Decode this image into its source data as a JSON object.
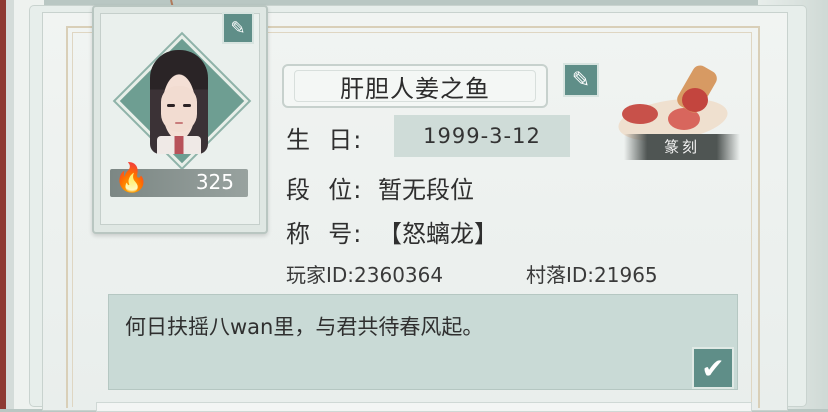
{
  "profile": {
    "nickname": "肝胆人姜之鱼",
    "heat_value": "325",
    "birthday_label": "生  日:",
    "birthday_value": "1999-3-12",
    "rank_label": "段  位:",
    "rank_value": "暂无段位",
    "title_label": "称  号:",
    "title_value": "【怒螭龙】",
    "player_id": "玩家ID:2360364",
    "village_id": "村落ID:21965",
    "signature": "何日扶摇八wan里，与君共待春风起。"
  },
  "stamp": {
    "label": "篆刻"
  },
  "icons": {
    "edit": "pencil-icon",
    "confirm": "checkmark-icon",
    "heat": "flame-icon"
  },
  "colors": {
    "button": "#5f8e88",
    "panel": "#c9dad6",
    "accent_red": "#c3453e"
  }
}
